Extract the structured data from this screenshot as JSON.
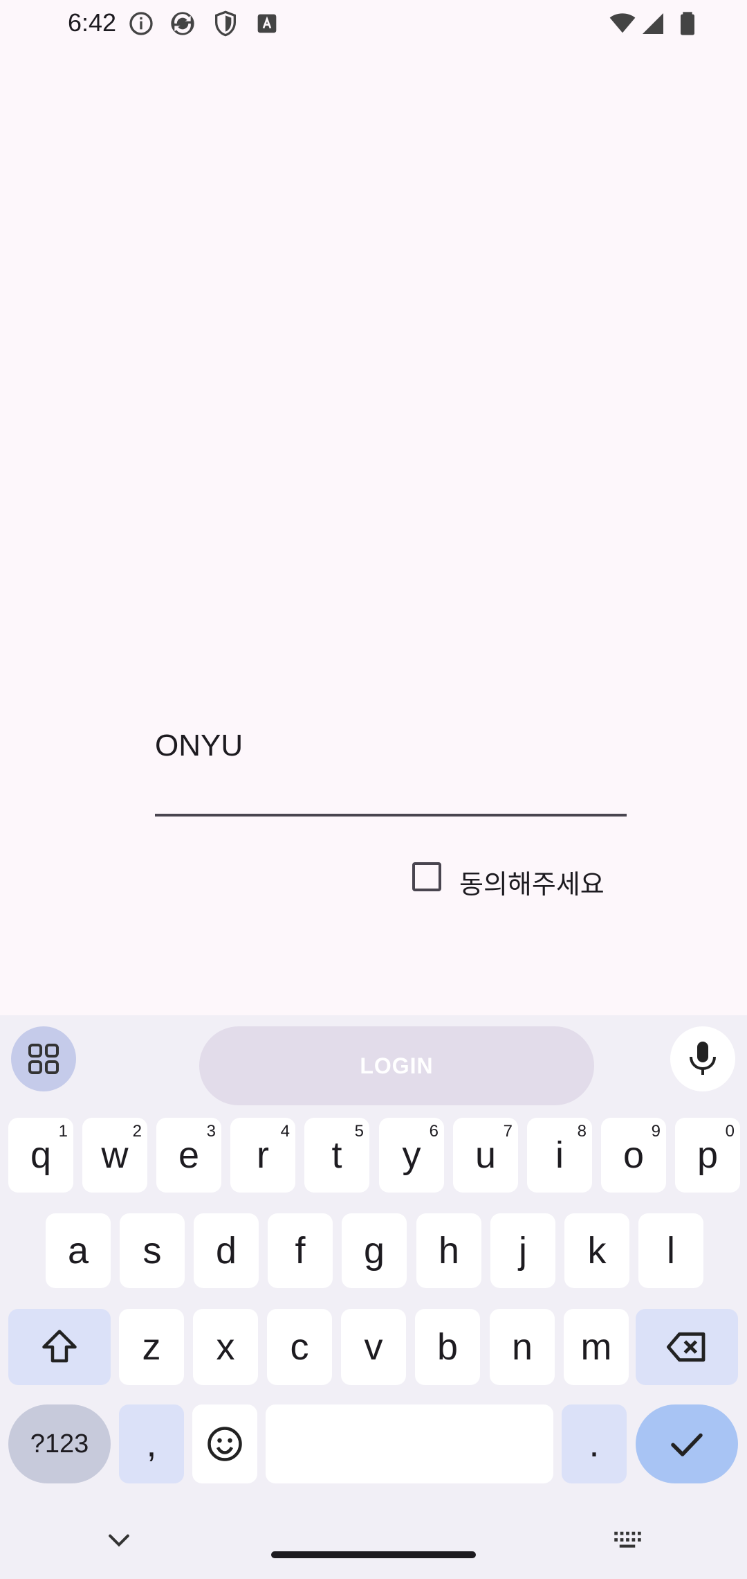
{
  "status_bar": {
    "time": "6:42"
  },
  "form": {
    "username_value": "ONYU",
    "agree_label": "동의해주세요",
    "agree_checked": false
  },
  "keyboard": {
    "suggestion_button": "LOGIN",
    "row1": [
      {
        "label": "q",
        "hint": "1"
      },
      {
        "label": "w",
        "hint": "2"
      },
      {
        "label": "e",
        "hint": "3"
      },
      {
        "label": "r",
        "hint": "4"
      },
      {
        "label": "t",
        "hint": "5"
      },
      {
        "label": "y",
        "hint": "6"
      },
      {
        "label": "u",
        "hint": "7"
      },
      {
        "label": "i",
        "hint": "8"
      },
      {
        "label": "o",
        "hint": "9"
      },
      {
        "label": "p",
        "hint": "0"
      }
    ],
    "row2": [
      "a",
      "s",
      "d",
      "f",
      "g",
      "h",
      "j",
      "k",
      "l"
    ],
    "row3": [
      "z",
      "x",
      "c",
      "v",
      "b",
      "n",
      "m"
    ],
    "symbols_label": "?123",
    "comma_label": ",",
    "period_label": "."
  },
  "icons": {
    "status": [
      "info-icon",
      "sync-icon",
      "shield-icon",
      "font-icon",
      "wifi-icon",
      "signal-icon",
      "battery-icon"
    ],
    "keyboard": [
      "apps-grid-icon",
      "mic-icon",
      "shift-icon",
      "backspace-icon",
      "emoji-icon",
      "check-icon"
    ],
    "nav": [
      "hide-keyboard-icon",
      "keyboard-switch-icon"
    ]
  },
  "colors": {
    "background": "#fdf7fb",
    "keyboard_bg": "#f1eff6",
    "accent": "#a8c4f4",
    "modifier_key": "#dbe1f8"
  }
}
